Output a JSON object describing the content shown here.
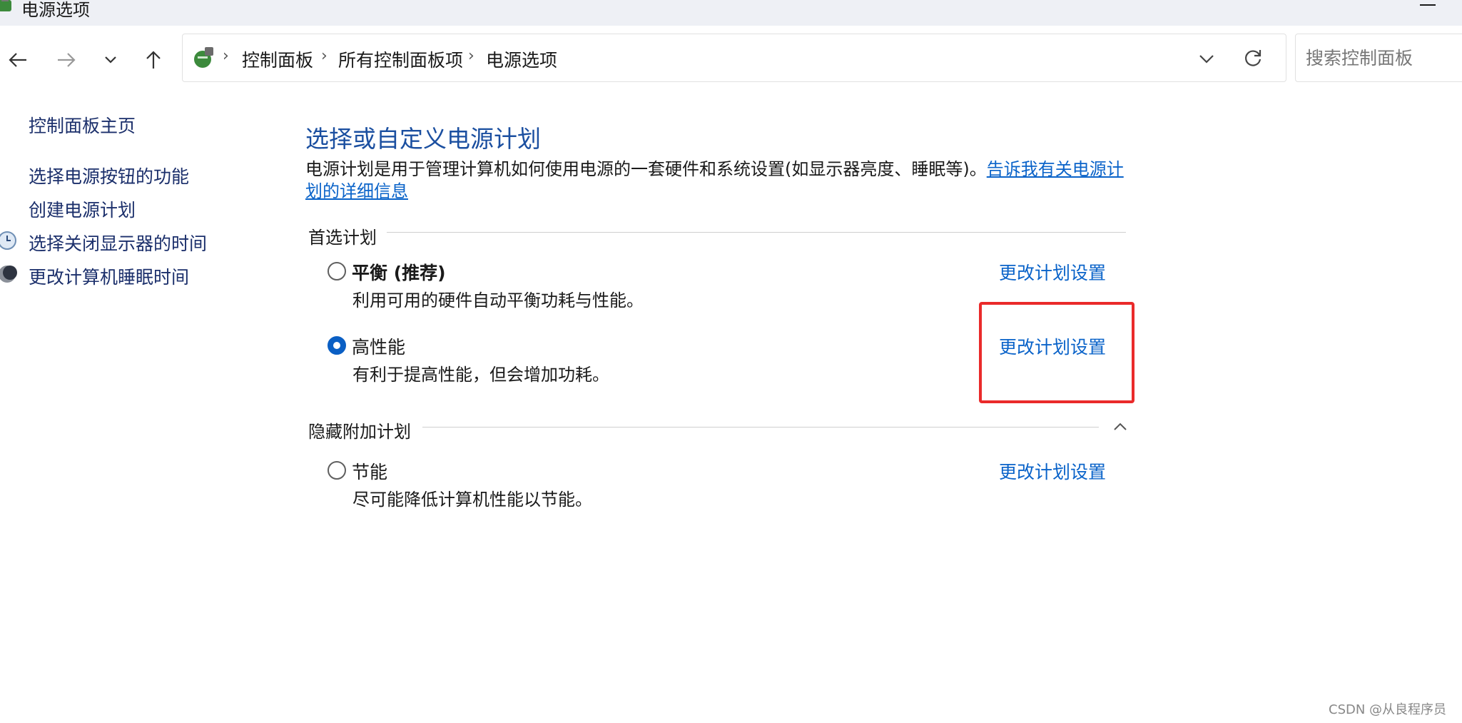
{
  "window": {
    "title": "电源选项"
  },
  "address_bar": {
    "breadcrumbs": [
      "控制面板",
      "所有控制面板项",
      "电源选项"
    ]
  },
  "search": {
    "placeholder": "搜索控制面板"
  },
  "sidebar": {
    "home": "控制面板主页",
    "items": [
      {
        "label": "选择电源按钮的功能",
        "icon": ""
      },
      {
        "label": "创建电源计划",
        "icon": ""
      },
      {
        "label": "选择关闭显示器的时间",
        "icon": "clock-icon"
      },
      {
        "label": "更改计算机睡眠时间",
        "icon": "moon-icon"
      }
    ]
  },
  "main": {
    "title": "选择或自定义电源计划",
    "description": "电源计划是用于管理计算机如何使用电源的一套硬件和系统设置(如显示器亮度、睡眠等)。",
    "description_link": "告诉我有关电源计划的详细信息",
    "preferred_section": "首选计划",
    "hidden_section": "隐藏附加计划",
    "plans": [
      {
        "name": "平衡 (推荐)",
        "desc": "利用可用的硬件自动平衡功耗与性能。",
        "link": "更改计划设置",
        "selected": false
      },
      {
        "name": "高性能",
        "desc": "有利于提高性能，但会增加功耗。",
        "link": "更改计划设置",
        "selected": true
      },
      {
        "name": "节能",
        "desc": "尽可能降低计算机性能以节能。",
        "link": "更改计划设置",
        "selected": false
      }
    ]
  },
  "watermark": "CSDN @从良程序员",
  "colors": {
    "link": "#0a63c9",
    "title": "#1b4fa0",
    "highlight": "#ea2a2a",
    "radio_selected": "#0a5fc4"
  }
}
